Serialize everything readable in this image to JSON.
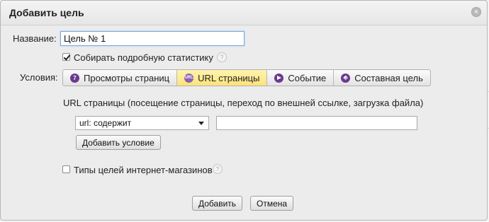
{
  "dialog": {
    "title": "Добавить цель"
  },
  "form": {
    "name_label": "Название:",
    "name_value": "Цель № 1",
    "detailed_stats_label": "Собирать подробную статистику",
    "conditions_label": "Условия:",
    "url_description": "URL страницы (посещение страницы, переход по внешней ссылке, загрузка файла)",
    "match_select_value": "url: содержит",
    "url_value": "",
    "add_condition_label": "Добавить условие",
    "ecommerce_label": "Типы целей интернет-магазинов"
  },
  "tabs": [
    {
      "label": "Просмотры страниц",
      "icon": "page-views-icon",
      "icon_text": "7",
      "active": false
    },
    {
      "label": "URL страницы",
      "icon": "url-icon",
      "icon_text": "URL",
      "active": true
    },
    {
      "label": "Событие",
      "icon": "event-icon",
      "icon_text": "",
      "active": false
    },
    {
      "label": "Составная цель",
      "icon": "composite-goal-icon",
      "icon_text": "",
      "active": false
    }
  ],
  "checkboxes": {
    "detailed_stats_checked": true,
    "ecommerce_checked": false
  },
  "footer": {
    "add_label": "Добавить",
    "cancel_label": "Отмена"
  },
  "icons": {
    "close": "×",
    "help": "?"
  },
  "colors": {
    "active_tab": "#fde37a",
    "tab_icon": "#6a3a8d",
    "input_focus_border": "#7ea7de"
  }
}
